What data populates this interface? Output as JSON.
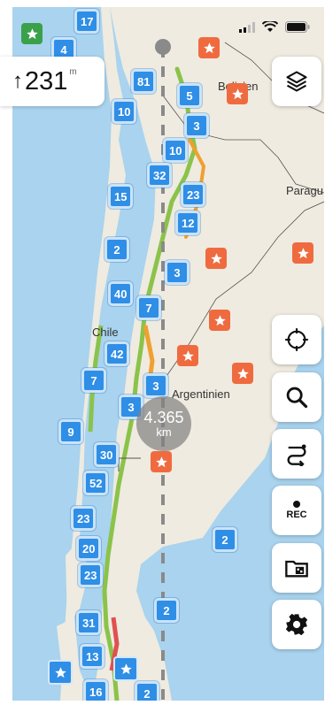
{
  "altitude": {
    "arrow": "↑",
    "value": "231",
    "unit": "m"
  },
  "distance": {
    "value": "4.365",
    "unit": "km"
  },
  "places": [
    {
      "name": "Bolivien",
      "id": "place-bolivien"
    },
    {
      "name": "Paragu",
      "id": "place-paraguay"
    },
    {
      "name": "Chile",
      "id": "place-chile"
    },
    {
      "name": "Argentinien",
      "id": "place-argentinien"
    }
  ],
  "clusters": [
    "17",
    "4",
    "81",
    "5",
    "10",
    "3",
    "10",
    "32",
    "23",
    "15",
    "12",
    "2",
    "3",
    "40",
    "7",
    "42",
    "7",
    "3",
    "3",
    "9",
    "30",
    "52",
    "23",
    "20",
    "23",
    "2",
    "2",
    "31",
    "13",
    "16",
    "2"
  ],
  "controls": {
    "rec_label": "REC"
  },
  "colors": {
    "water": "#a9d3ee",
    "land": "#efebe0",
    "cluster": "#2f8ee6",
    "poi": "#ef6b3f",
    "route_dash": "#8a8a8a"
  }
}
